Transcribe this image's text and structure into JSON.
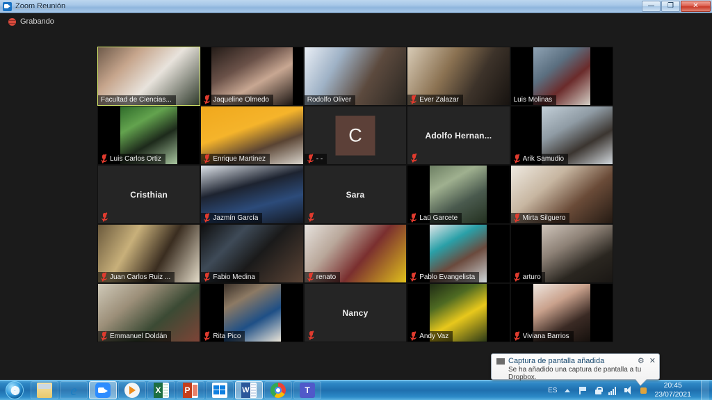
{
  "window": {
    "title": "Zoom Reunión",
    "app_icon": "zoom-icon",
    "minimize_label": "—",
    "maximize_label": "❐",
    "close_label": "✕"
  },
  "meeting": {
    "recording_label": "Grabando",
    "recording_icon": "recording-icon",
    "mic_muted_icon": "mic-muted-icon",
    "active_speaker_color": "#d7e96a",
    "tiles": [
      {
        "name": "Facultad de Ciencias...",
        "type": "video",
        "active": true,
        "muted": false,
        "label_pos": "bar",
        "frame": "full",
        "bg": "linear-gradient(135deg,#6e5a4a 0%,#c6a58c 28%,#e8e3dc 55%,#2f3a2c 100%)"
      },
      {
        "name": "Jaqueline Olmedo",
        "type": "video",
        "active": false,
        "muted": true,
        "label_pos": "bar",
        "frame": "inset-wide",
        "bg": "linear-gradient(150deg,#241c18 0%,#6a5148 35%,#c8a792 60%,#1d1714 100%)"
      },
      {
        "name": "Rodolfo Oliver",
        "type": "video",
        "active": false,
        "muted": false,
        "label_pos": "bar",
        "frame": "full",
        "bg": "linear-gradient(120deg,#e9eef5 0%,#9fb2c6 30%,#5c4a3e 62%,#2b2722 100%)"
      },
      {
        "name": "Ever Zalazar",
        "type": "video",
        "active": false,
        "muted": true,
        "label_pos": "bar",
        "frame": "full",
        "bg": "linear-gradient(120deg,#d8cbb6 0%,#8b7252 38%,#3d332a 66%,#171310 100%)"
      },
      {
        "name": "Luis Molinas",
        "type": "video",
        "active": false,
        "muted": false,
        "label_pos": "bar",
        "frame": "inset",
        "bg": "linear-gradient(140deg,#8fa3b4 0%,#5b6f80 35%,#6b2b2b 62%,#d5cfc6 100%)"
      },
      {
        "name": "Luis Carlos Ortiz",
        "type": "video",
        "active": false,
        "muted": true,
        "label_pos": "bar",
        "frame": "inset",
        "bg": "linear-gradient(150deg,#2f6b2a 0%,#63a34e 30%,#1d2a1b 60%,#a9c6a0 100%)"
      },
      {
        "name": "Enrique Martinez",
        "type": "video",
        "active": false,
        "muted": true,
        "label_pos": "bar",
        "frame": "full",
        "bg": "linear-gradient(160deg,#f0a81c 0%,#f5b42b 40%,#5a4433 68%,#d9d4cc 100%)"
      },
      {
        "name": "- -",
        "type": "avatar",
        "active": false,
        "muted": true,
        "label_pos": "bar",
        "avatar_letter": "C",
        "avatar_bg": "#5c4038"
      },
      {
        "name": "Adolfo  Hernan...",
        "type": "name",
        "active": false,
        "muted": true,
        "label_pos": "center"
      },
      {
        "name": "Arik Samudio",
        "type": "video",
        "active": false,
        "muted": true,
        "label_pos": "bar",
        "frame": "inset-r",
        "bg": "linear-gradient(150deg,#c3cfd8 0%,#8f9ba4 35%,#3b3530 65%,#d2d8dd 100%)"
      },
      {
        "name": "Cristhian",
        "type": "name",
        "active": false,
        "muted": true,
        "label_pos": "center"
      },
      {
        "name": "Jazmín García",
        "type": "video",
        "active": false,
        "muted": true,
        "label_pos": "bar",
        "frame": "full",
        "bg": "linear-gradient(165deg,#dfe4ea 0%,#1d2330 38%,#2c4b7a 66%,#141820 100%)"
      },
      {
        "name": "Sara",
        "type": "name",
        "active": false,
        "muted": true,
        "label_pos": "center"
      },
      {
        "name": "Laü Garcete",
        "type": "video",
        "active": false,
        "muted": true,
        "label_pos": "bar",
        "frame": "inset",
        "bg": "linear-gradient(150deg,#6d7f63 0%,#9fb08f 30%,#4a5a4e 62%,#23301f 100%)"
      },
      {
        "name": "Mirta Silguero",
        "type": "video",
        "active": false,
        "muted": true,
        "label_pos": "bar",
        "frame": "full",
        "bg": "linear-gradient(140deg,#efeae1 0%,#c7b6a1 35%,#6a4b38 65%,#241a13 100%)"
      },
      {
        "name": "Juan Carlos Ruiz ...",
        "type": "video",
        "active": false,
        "muted": true,
        "label_pos": "bar",
        "frame": "full",
        "bg": "linear-gradient(120deg,#6b5a3d 0%,#c8b07a 32%,#3a2d20 62%,#e4dcc9 100%)"
      },
      {
        "name": "Fabio Medina",
        "type": "video",
        "active": false,
        "muted": true,
        "label_pos": "bar",
        "frame": "full",
        "bg": "linear-gradient(135deg,#0e0e0e 0%,#3e4a57 30%,#1a1a1a 55%,#5a4335 100%)"
      },
      {
        "name": "renato",
        "type": "video",
        "active": false,
        "muted": true,
        "label_pos": "bar",
        "frame": "full",
        "bg": "linear-gradient(130deg,#e6e2dd 0%,#b9a79a 30%,#7a2f2f 58%,#e0c01c 100%)"
      },
      {
        "name": "Pablo Evangelista",
        "type": "video",
        "active": false,
        "muted": true,
        "label_pos": "bar",
        "frame": "inset",
        "bg": "linear-gradient(150deg,#dfe6e8 0%,#2aa0a8 32%,#6b4a3d 60%,#cfd6d8 100%)"
      },
      {
        "name": "arturo",
        "type": "video",
        "active": false,
        "muted": true,
        "label_pos": "bar",
        "frame": "inset-r",
        "bg": "linear-gradient(150deg,#cfc5bb 0%,#8d8176 35%,#2a2620 68%,#1a1714 100%)"
      },
      {
        "name": "Emmanuel Doldán",
        "type": "video",
        "active": false,
        "muted": true,
        "label_pos": "bar",
        "frame": "full",
        "bg": "linear-gradient(140deg,#cfc9b8 0%,#9c8f79 32%,#3b4a34 62%,#7d4437 100%)"
      },
      {
        "name": "Rita Pico",
        "type": "video",
        "active": false,
        "muted": true,
        "label_pos": "bar",
        "frame": "inset",
        "bg": "linear-gradient(150deg,#3a3028 0%,#8d7a64 28%,#1e4f86 62%,#eae4d8 100%)"
      },
      {
        "name": "Nancy",
        "type": "name",
        "active": false,
        "muted": true,
        "label_pos": "center"
      },
      {
        "name": "Andy Vaz",
        "type": "video",
        "active": false,
        "muted": true,
        "label_pos": "bar",
        "frame": "inset",
        "bg": "linear-gradient(150deg,#1f2b15 0%,#4e6a22 30%,#e8c81c 58%,#2c3a18 100%)"
      },
      {
        "name": "Viviana Barrios",
        "type": "video",
        "active": false,
        "muted": true,
        "label_pos": "bar",
        "frame": "inset",
        "bg": "linear-gradient(150deg,#efe7e0 0%,#c9a18c 35%,#3a2a24 68%,#15100d 100%)"
      }
    ]
  },
  "toast": {
    "icon": "dropbox-icon",
    "title": "Captura de pantalla añadida",
    "body": "Se ha añadido una captura de pantalla a tu Dropbox.",
    "settings_label": "⚙",
    "close_label": "✕"
  },
  "taskbar": {
    "start_label": "start-orb",
    "items": [
      {
        "icon": "explorer-icon",
        "cls": "explorer",
        "label": "",
        "active": false
      },
      {
        "icon": "internet-explorer-icon",
        "cls": "ie",
        "label": "e",
        "active": false
      },
      {
        "icon": "zoom-icon",
        "cls": "zoom",
        "label": "",
        "active": true
      },
      {
        "icon": "media-player-icon",
        "cls": "vlc",
        "label": "",
        "active": false
      },
      {
        "icon": "excel-icon",
        "cls": "excel",
        "label": "",
        "active": false
      },
      {
        "icon": "powerpoint-icon",
        "cls": "ppt",
        "label": "",
        "active": false
      },
      {
        "icon": "dropbox-icon",
        "cls": "dropbox",
        "label": "",
        "active": false
      },
      {
        "icon": "word-icon",
        "cls": "word",
        "label": "",
        "active": true
      },
      {
        "icon": "chrome-icon",
        "cls": "chrome",
        "label": "",
        "active": false
      },
      {
        "icon": "teams-icon",
        "cls": "teams",
        "label": "T",
        "active": false
      }
    ],
    "tray": {
      "language": "ES",
      "icons": [
        "show-hidden-icons",
        "action-center-icon",
        "security-icon",
        "network-icon",
        "volume-icon",
        "dropbox-tray-icon"
      ],
      "time": "20:45",
      "date": "23/07/2021"
    }
  }
}
